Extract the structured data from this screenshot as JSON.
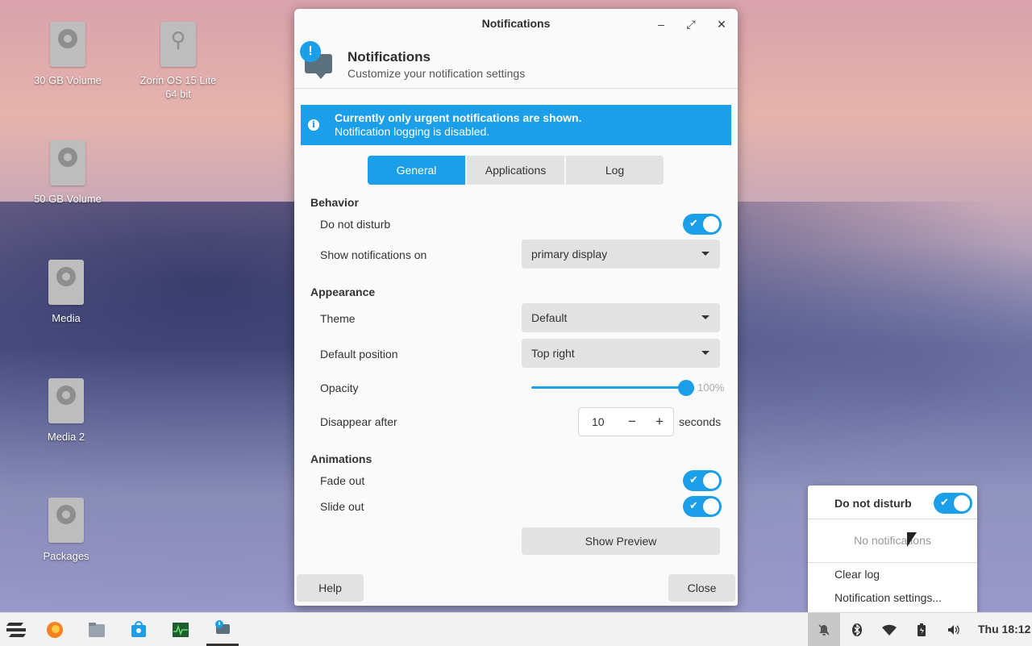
{
  "desktop": {
    "icons": [
      {
        "label": "30 GB Volume",
        "type": "drive"
      },
      {
        "label": "Zorin OS 15 Lite 64 bit",
        "type": "usb"
      },
      {
        "label": "50 GB Volume",
        "type": "drive"
      },
      {
        "label": "Media",
        "type": "drive"
      },
      {
        "label": "Media 2",
        "type": "drive"
      },
      {
        "label": "Packages",
        "type": "drive"
      }
    ]
  },
  "window": {
    "title": "Notifications",
    "controls": {
      "minimize": "–",
      "maximize": "⤢",
      "close": "✕"
    },
    "header": {
      "title": "Notifications",
      "subtitle": "Customize your notification settings",
      "icon": "notification-bubble-icon"
    },
    "infobar": {
      "line1": "Currently only urgent notifications are shown.",
      "line2": "Notification logging is disabled.",
      "icon": "i"
    },
    "tabs": [
      {
        "label": "General",
        "active": true
      },
      {
        "label": "Applications",
        "active": false
      },
      {
        "label": "Log",
        "active": false
      }
    ],
    "behavior": {
      "section": "Behavior",
      "do_not_disturb": {
        "label": "Do not disturb",
        "on": true
      },
      "show_on": {
        "label": "Show notifications on",
        "value": "primary display"
      }
    },
    "appearance": {
      "section": "Appearance",
      "theme": {
        "label": "Theme",
        "value": "Default"
      },
      "position": {
        "label": "Default position",
        "value": "Top right"
      },
      "opacity": {
        "label": "Opacity",
        "value": 1.0,
        "display": "100%"
      },
      "disappear": {
        "label": "Disappear after",
        "value": "10",
        "minus": "−",
        "plus": "+",
        "unit": "seconds"
      }
    },
    "animations": {
      "section": "Animations",
      "fade_out": {
        "label": "Fade out",
        "on": true
      },
      "slide_out": {
        "label": "Slide out",
        "on": true
      }
    },
    "preview_button": "Show Preview",
    "help_button": "Help",
    "close_button": "Close"
  },
  "popover": {
    "dnd_label": "Do not disturb",
    "dnd_on": true,
    "empty_text": "No notifications",
    "clear_log": "Clear log",
    "settings": "Notification settings..."
  },
  "taskbar": {
    "apps": [
      "zorin-menu-icon",
      "firefox-icon",
      "files-icon",
      "software-store-icon",
      "system-monitor-icon",
      "notifications-app-icon"
    ],
    "tray": [
      "notifications-disabled-icon",
      "bluetooth-icon",
      "wifi-icon",
      "battery-icon",
      "volume-icon"
    ],
    "clock": "Thu 18:12"
  },
  "colors": {
    "accent": "#1a9fe8",
    "window_bg": "#fafafa",
    "button_bg": "#e2e2e2"
  }
}
